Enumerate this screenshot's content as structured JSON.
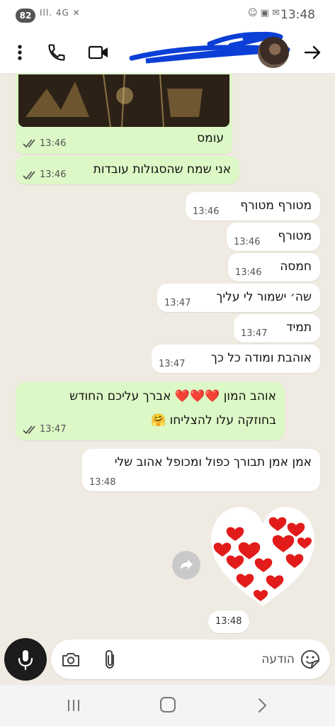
{
  "status_bar": {
    "battery": "82",
    "network": "4G",
    "time": "13:48"
  },
  "header": {
    "contact_name": "…"
  },
  "messages": [
    {
      "direction": "outgoing",
      "text": "עומס",
      "time": "13:46",
      "read": true
    },
    {
      "direction": "outgoing",
      "text": "אני שמח שהסגולות עובדות",
      "time": "13:46",
      "read": true
    },
    {
      "direction": "incoming",
      "text": "מטורף מטורף",
      "time": "13:46"
    },
    {
      "direction": "incoming",
      "text": "מטורף",
      "time": "13:46"
    },
    {
      "direction": "incoming",
      "text": "חמסה",
      "time": "13:46"
    },
    {
      "direction": "incoming",
      "text": "שה׳ ישמור לי עליך",
      "time": "13:47"
    },
    {
      "direction": "incoming",
      "text": "תמיד",
      "time": "13:47"
    },
    {
      "direction": "incoming",
      "text": "אוהבת ומודה כל כך",
      "time": "13:47"
    },
    {
      "direction": "outgoing",
      "text_line1": "אוהב המון ❤️❤️❤️ אברך עליכם החודש",
      "text_line2": "בחוזקה עלו להצליחו 🤗",
      "time": "13:47",
      "read": true
    },
    {
      "direction": "incoming",
      "text": "אמן אמן תבורך כפול ומכופל אהוב שלי",
      "time": "13:48"
    },
    {
      "direction": "incoming",
      "type": "sticker",
      "sticker": "heart-made-of-hearts",
      "time": "13:48"
    }
  ],
  "composer": {
    "placeholder": "הודעה"
  },
  "colors": {
    "outgoing_bubble": "#dcf8c6",
    "incoming_bubble": "#ffffff",
    "chat_background": "#efeae2",
    "read_ticks": "#4a4a4a",
    "mic_button": "#1c1c1c",
    "scribble": "#0b3fd6"
  },
  "icons": [
    "more-vert-icon",
    "phone-icon",
    "videocam-icon",
    "arrow-forward-icon",
    "mic-icon",
    "camera-icon",
    "attach-icon",
    "sticker-icon",
    "forward-icon"
  ]
}
